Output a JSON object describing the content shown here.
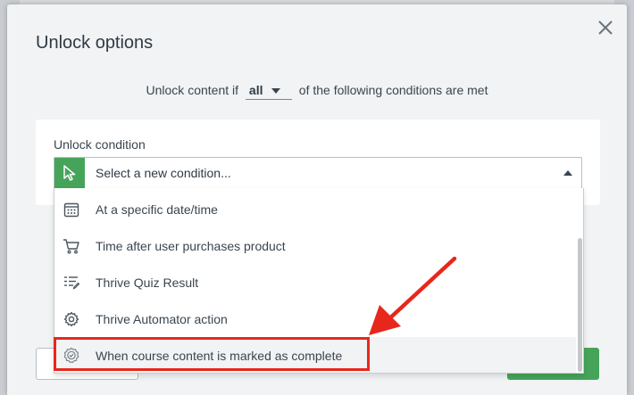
{
  "dialog": {
    "title": "Unlock options"
  },
  "unlock_rule": {
    "prefix": "Unlock content if",
    "selected": "all",
    "suffix": "of the following conditions are met"
  },
  "condition": {
    "label": "Unlock condition",
    "placeholder": "Select a new condition..."
  },
  "dropdown": {
    "items": [
      {
        "label": "At a specific date/time",
        "icon": "calendar-icon"
      },
      {
        "label": "Time after user purchases product",
        "icon": "cart-icon"
      },
      {
        "label": "Thrive Quiz Result",
        "icon": "quiz-list-icon"
      },
      {
        "label": "Thrive Automator action",
        "icon": "gear-icon"
      },
      {
        "label": "When course content is marked as complete",
        "icon": "badge-check-icon"
      }
    ]
  },
  "colors": {
    "accent_green": "#46a45a",
    "highlight_red": "#e8271c",
    "text_dark": "#2f3a44"
  }
}
